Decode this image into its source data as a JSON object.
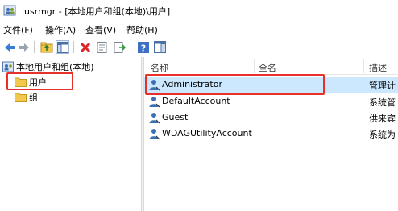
{
  "window": {
    "title": "lusrmgr - [本地用户和组(本地)\\用户]"
  },
  "menu": [
    "文件(F)",
    "操作(A)",
    "查看(V)",
    "帮助(H)"
  ],
  "toolbar": [
    "back-icon",
    "forward-icon",
    "up-folder-icon",
    "show-tree-icon",
    "delete-icon",
    "properties-icon",
    "export-icon",
    "help-icon",
    "show-action-pane-icon"
  ],
  "tree": {
    "root": "本地用户和组(本地)",
    "items": [
      {
        "label": "用户",
        "selected": true
      },
      {
        "label": "组",
        "selected": false
      }
    ]
  },
  "list": {
    "columns": [
      "名称",
      "全名",
      "描述"
    ],
    "rows": [
      {
        "name": "Administrator",
        "full_name": "",
        "description": "管理计",
        "selected": true
      },
      {
        "name": "DefaultAccount",
        "full_name": "",
        "description": "系统管",
        "selected": false
      },
      {
        "name": "Guest",
        "full_name": "",
        "description": "供来宾",
        "selected": false
      },
      {
        "name": "WDAGUtilityAccount",
        "full_name": "",
        "description": "系统为",
        "selected": false
      }
    ]
  },
  "colors": {
    "selection": "#cce8ff",
    "highlight_box": "#e8302a",
    "folder": "#f3c94d"
  }
}
